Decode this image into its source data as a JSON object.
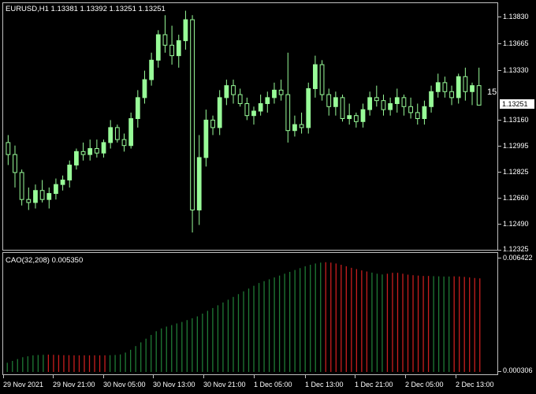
{
  "chart_header": {
    "symbol_label": "EURUSD,H1",
    "ohlc": "1.13381 1.13392 1.13251 1.13251"
  },
  "current_price": "1.13251",
  "shift_marker": "15",
  "price_axis": [
    "1.13830",
    "1.13665",
    "1.13330",
    "1.13160",
    "1.12995",
    "1.12825",
    "1.12660",
    "1.12490",
    "1.12325"
  ],
  "indicator": {
    "label": "CAO(32,208) 0.005350",
    "axis_top": "0.006422",
    "axis_bottom": "0.000306"
  },
  "time_axis": [
    "29 Nov 2021",
    "29 Nov 21:00",
    "30 Nov 05:00",
    "30 Nov 13:00",
    "30 Nov 21:00",
    "1 Dec 05:00",
    "1 Dec 13:00",
    "1 Dec 21:00",
    "2 Dec 05:00",
    "2 Dec 13:00"
  ],
  "colors": {
    "bull_candle": "#98fb98",
    "bear_candle": "#000000",
    "candle_outline": "#98fb98",
    "hist_up": "#1f7a35",
    "hist_down": "#c81e1e",
    "background": "#000000",
    "frame": "#c0c0c0"
  },
  "chart_data": [
    {
      "type": "candlestick",
      "title": "EURUSD,H1",
      "ylim": [
        1.123,
        1.1392
      ],
      "candles": [
        [
          1.13,
          1.1305,
          1.1285,
          1.1292
        ],
        [
          1.1292,
          1.1298,
          1.127,
          1.128
        ],
        [
          1.128,
          1.1282,
          1.1258,
          1.1262
        ],
        [
          1.1262,
          1.127,
          1.1255,
          1.126
        ],
        [
          1.126,
          1.1272,
          1.1256,
          1.1268
        ],
        [
          1.1268,
          1.1275,
          1.126,
          1.1262
        ],
        [
          1.1262,
          1.127,
          1.1256,
          1.1266
        ],
        [
          1.1266,
          1.1276,
          1.1262,
          1.1272
        ],
        [
          1.1272,
          1.1278,
          1.1268,
          1.1275
        ],
        [
          1.1275,
          1.1288,
          1.127,
          1.1285
        ],
        [
          1.1285,
          1.1296,
          1.1282,
          1.1294
        ],
        [
          1.1294,
          1.13,
          1.1288,
          1.1292
        ],
        [
          1.1292,
          1.1302,
          1.1288,
          1.1296
        ],
        [
          1.1296,
          1.1302,
          1.129,
          1.1293
        ],
        [
          1.1293,
          1.1302,
          1.129,
          1.13
        ],
        [
          1.13,
          1.1315,
          1.1296,
          1.131
        ],
        [
          1.131,
          1.1312,
          1.13,
          1.1302
        ],
        [
          1.1302,
          1.1306,
          1.1294,
          1.1298
        ],
        [
          1.1298,
          1.132,
          1.1296,
          1.1316
        ],
        [
          1.1316,
          1.1335,
          1.131,
          1.133
        ],
        [
          1.133,
          1.1348,
          1.1326,
          1.1342
        ],
        [
          1.1342,
          1.136,
          1.1338,
          1.1355
        ],
        [
          1.1355,
          1.1375,
          1.135,
          1.1372
        ],
        [
          1.1372,
          1.1385,
          1.136,
          1.1365
        ],
        [
          1.1365,
          1.1378,
          1.1352,
          1.1358
        ],
        [
          1.1358,
          1.1372,
          1.135,
          1.1368
        ],
        [
          1.1368,
          1.1388,
          1.1362,
          1.1382
        ],
        [
          1.1382,
          1.1385,
          1.124,
          1.1255
        ],
        [
          1.1255,
          1.1305,
          1.1245,
          1.129
        ],
        [
          1.129,
          1.1322,
          1.1284,
          1.1315
        ],
        [
          1.1315,
          1.1318,
          1.1305,
          1.131
        ],
        [
          1.131,
          1.1335,
          1.1305,
          1.133
        ],
        [
          1.133,
          1.1342,
          1.1325,
          1.1338
        ],
        [
          1.1338,
          1.1342,
          1.1326,
          1.1332
        ],
        [
          1.1332,
          1.1336,
          1.1324,
          1.1326
        ],
        [
          1.1326,
          1.133,
          1.1315,
          1.1318
        ],
        [
          1.1318,
          1.1324,
          1.1312,
          1.1321
        ],
        [
          1.1321,
          1.1332,
          1.1318,
          1.1326
        ],
        [
          1.1326,
          1.1334,
          1.132,
          1.133
        ],
        [
          1.133,
          1.134,
          1.1326,
          1.1335
        ],
        [
          1.1335,
          1.1342,
          1.1328,
          1.1332
        ],
        [
          1.1332,
          1.136,
          1.13,
          1.1308
        ],
        [
          1.1308,
          1.1318,
          1.1304,
          1.1312
        ],
        [
          1.1312,
          1.132,
          1.1306,
          1.131
        ],
        [
          1.131,
          1.134,
          1.1306,
          1.1336
        ],
        [
          1.1336,
          1.1358,
          1.133,
          1.1352
        ],
        [
          1.1352,
          1.1355,
          1.1328,
          1.1332
        ],
        [
          1.1332,
          1.1336,
          1.1318,
          1.1324
        ],
        [
          1.1324,
          1.1334,
          1.1318,
          1.133
        ],
        [
          1.133,
          1.1332,
          1.1314,
          1.1316
        ],
        [
          1.1316,
          1.1326,
          1.1312,
          1.1318
        ],
        [
          1.1318,
          1.132,
          1.131,
          1.1314
        ],
        [
          1.1314,
          1.1326,
          1.131,
          1.1322
        ],
        [
          1.1322,
          1.1334,
          1.1318,
          1.133
        ],
        [
          1.133,
          1.1338,
          1.1324,
          1.1328
        ],
        [
          1.1328,
          1.1332,
          1.1318,
          1.1322
        ],
        [
          1.1322,
          1.133,
          1.1318,
          1.1326
        ],
        [
          1.1326,
          1.1336,
          1.132,
          1.133
        ],
        [
          1.133,
          1.1332,
          1.1318,
          1.1324
        ],
        [
          1.1324,
          1.133,
          1.1316,
          1.132
        ],
        [
          1.132,
          1.1326,
          1.1312,
          1.1316
        ],
        [
          1.1316,
          1.1328,
          1.1312,
          1.1324
        ],
        [
          1.1324,
          1.1338,
          1.132,
          1.1334
        ],
        [
          1.1334,
          1.1346,
          1.133,
          1.134
        ],
        [
          1.134,
          1.1344,
          1.133,
          1.1334
        ],
        [
          1.1334,
          1.1338,
          1.1325,
          1.133
        ],
        [
          1.133,
          1.1346,
          1.1326,
          1.1344
        ],
        [
          1.1344,
          1.135,
          1.1328,
          1.1334
        ],
        [
          1.1334,
          1.134,
          1.1325,
          1.1338
        ],
        [
          1.1338,
          1.135,
          1.133,
          1.1325
        ]
      ]
    },
    {
      "type": "bar",
      "title": "CAO(32,208) 0.005350",
      "ylim": [
        0.000306,
        0.006422
      ],
      "values": [
        0.0008,
        0.0009,
        0.001,
        0.0011,
        0.00115,
        0.0012,
        0.00122,
        0.00123,
        0.00124,
        0.00123,
        0.00122,
        0.00121,
        0.00121,
        0.0012,
        0.0012,
        0.0012,
        0.0012,
        0.0012,
        0.0012,
        0.0012,
        0.00121,
        0.00122,
        0.00125,
        0.00135,
        0.0015,
        0.0017,
        0.0019,
        0.0021,
        0.0023,
        0.0025,
        0.00265,
        0.00275,
        0.00283,
        0.00292,
        0.003,
        0.0031,
        0.0032,
        0.0033,
        0.00345,
        0.0036,
        0.00375,
        0.0039,
        0.00405,
        0.0042,
        0.00435,
        0.0045,
        0.00465,
        0.0048,
        0.00495,
        0.0051,
        0.0052,
        0.0053,
        0.0054,
        0.0055,
        0.0056,
        0.0057,
        0.0058,
        0.0059,
        0.006,
        0.00608,
        0.00615,
        0.0062,
        0.00622,
        0.0062,
        0.00615,
        0.00608,
        0.006,
        0.00592,
        0.00585,
        0.00578,
        0.00572,
        0.00566,
        0.0056,
        0.00556,
        0.0056,
        0.00565,
        0.00565,
        0.0056,
        0.00555,
        0.00552,
        0.0055,
        0.00548,
        0.00548,
        0.00547,
        0.00546,
        0.00545,
        0.00545,
        0.00546,
        0.00545,
        0.00543,
        0.0054,
        0.00537,
        0.00535
      ],
      "direction": [
        "up",
        "up",
        "up",
        "up",
        "up",
        "up",
        "up",
        "up",
        "down",
        "down",
        "down",
        "down",
        "down",
        "down",
        "down",
        "down",
        "down",
        "down",
        "down",
        "down",
        "up",
        "up",
        "up",
        "up",
        "up",
        "up",
        "up",
        "up",
        "up",
        "up",
        "up",
        "up",
        "up",
        "up",
        "up",
        "up",
        "up",
        "up",
        "up",
        "up",
        "up",
        "up",
        "up",
        "up",
        "up",
        "up",
        "up",
        "up",
        "up",
        "up",
        "up",
        "up",
        "up",
        "up",
        "up",
        "up",
        "up",
        "up",
        "up",
        "up",
        "up",
        "up",
        "down",
        "down",
        "down",
        "down",
        "down",
        "down",
        "down",
        "down",
        "down",
        "up",
        "up",
        "up",
        "down",
        "down",
        "down",
        "down",
        "down",
        "down",
        "down",
        "down",
        "down",
        "up",
        "up",
        "up",
        "up",
        "down",
        "down",
        "down",
        "down",
        "down",
        "down"
      ]
    }
  ]
}
